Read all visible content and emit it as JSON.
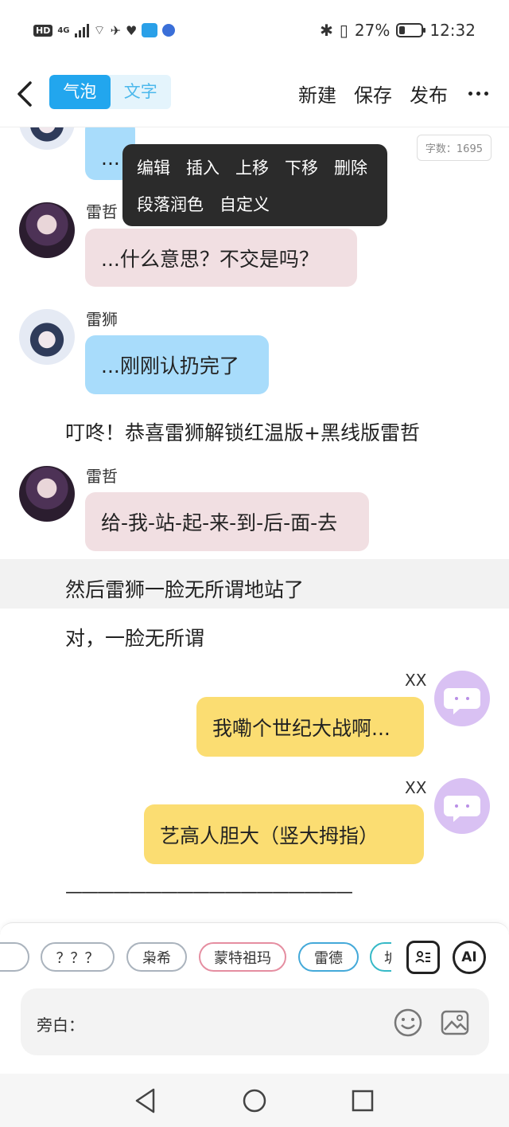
{
  "status_bar": {
    "hd": "HD",
    "network": "4G",
    "battery_percent": "27%",
    "battery_level": 0.27,
    "time": "12:32"
  },
  "toolbar": {
    "mode_bubble": "气泡",
    "mode_text": "文字",
    "new_label": "新建",
    "save_label": "保存",
    "publish_label": "发布"
  },
  "word_count": "字数：1695",
  "context_menu": {
    "row1": [
      "编辑",
      "插入",
      "上移",
      "下移",
      "删除"
    ],
    "row2": [
      "段落润色",
      "自定义"
    ]
  },
  "messages": [
    {
      "speaker": "",
      "text": "...",
      "color": "#a8dcfb"
    },
    {
      "speaker": "雷哲",
      "text": "...什么意思？不交是吗？",
      "color": "#f1dfe2"
    },
    {
      "speaker": "雷狮",
      "text": "...刚刚认扔完了",
      "color": "#a8dcfb"
    },
    {
      "speaker": "",
      "text": "叮咚！恭喜雷狮解锁红温版+黑线版雷哲"
    },
    {
      "speaker": "雷哲",
      "text": "给-我-站-起-来-到-后-面-去",
      "color": "#f1dfe2"
    },
    {
      "speaker": "",
      "text": "然后雷狮一脸无所谓地站了"
    },
    {
      "speaker": "",
      "text": "对，一脸无所谓"
    },
    {
      "speaker": "XX",
      "text": "我嘞个世纪大战啊...",
      "color": "#fbdd72"
    },
    {
      "speaker": "XX",
      "text": "艺高人胆大（竖大拇指）",
      "color": "#fbdd72"
    },
    {
      "speaker": "",
      "text": "——————————————————"
    }
  ],
  "characters": [
    "？？？",
    "枭希",
    "蒙特祖玛",
    "雷德",
    "圹"
  ],
  "ai_label": "AI",
  "input": {
    "label": "旁白："
  }
}
